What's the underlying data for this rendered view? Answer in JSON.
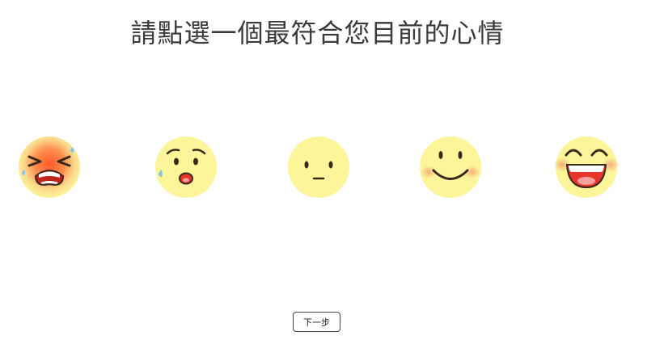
{
  "page": {
    "title": "請點選一個最符合您目前的心情"
  },
  "moods": [
    {
      "icon": "crying-face-icon"
    },
    {
      "icon": "worried-face-icon"
    },
    {
      "icon": "neutral-face-icon"
    },
    {
      "icon": "smiling-face-icon"
    },
    {
      "icon": "laughing-face-icon"
    }
  ],
  "actions": {
    "next_label": "下一步"
  },
  "colors": {
    "face_fill": "#fcf59a",
    "blush": "#f5a97a",
    "feature": "#3a2a1a",
    "mouth_red": "#e8352b",
    "tear_blue": "#7fc4ea",
    "title_text": "#3a3a3a"
  }
}
